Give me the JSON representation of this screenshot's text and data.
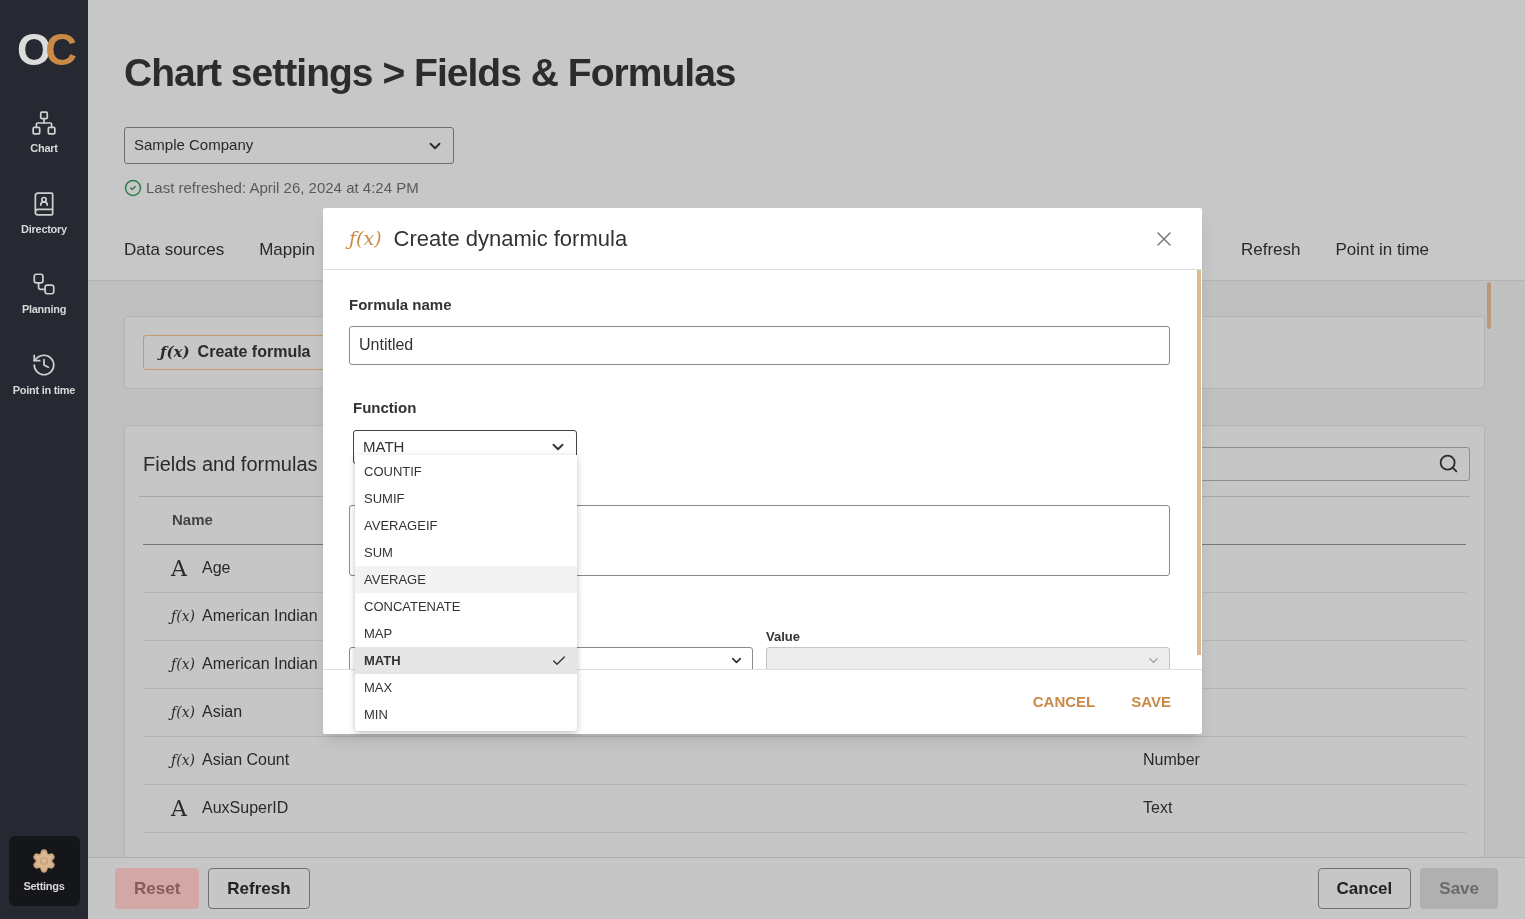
{
  "sidebar": {
    "logo": "OC",
    "items": [
      {
        "label": "Chart",
        "selected": false
      },
      {
        "label": "Directory",
        "selected": false
      },
      {
        "label": "Planning",
        "selected": false
      },
      {
        "label": "Point in time",
        "selected": false
      },
      {
        "label": "Settings",
        "selected": true
      }
    ]
  },
  "page": {
    "title": "Chart settings > Fields & Formulas",
    "company_select": {
      "value": "Sample Company"
    },
    "status": "Last refreshed: April 26, 2024 at 4:24 PM",
    "tabs": [
      {
        "label": "Data sources"
      },
      {
        "label": "Mappin"
      },
      {
        "label": "Refresh"
      },
      {
        "label": "Point in time"
      }
    ],
    "create_button": {
      "icon": "ƒ(x)",
      "label": "Create formula"
    },
    "fields": {
      "title": "Fields and formulas",
      "columns": [
        "Name"
      ],
      "rows": [
        {
          "icon": "A",
          "name": "Age"
        },
        {
          "icon": "ƒ(x)",
          "name": "American Indian"
        },
        {
          "icon": "ƒ(x)",
          "name": "American Indian"
        },
        {
          "icon": "ƒ(x)",
          "name": "Asian"
        },
        {
          "icon": "ƒ(x)",
          "name": "Asian Count",
          "type": "Number"
        },
        {
          "icon": "A",
          "name": "AuxSuperID",
          "type": "Text"
        }
      ]
    },
    "footer": {
      "left": [
        {
          "label": "Reset",
          "kind": "danger",
          "disabled": true
        },
        {
          "label": "Refresh",
          "kind": "outline",
          "disabled": false
        }
      ],
      "right": [
        {
          "label": "Cancel",
          "kind": "outline",
          "disabled": false
        },
        {
          "label": "Save",
          "kind": "primary",
          "disabled": true
        }
      ]
    }
  },
  "modal": {
    "icon": "ƒ(x)",
    "title": "Create dynamic formula",
    "formula_name": {
      "label": "Formula name",
      "value": "Untitled"
    },
    "function": {
      "label": "Function",
      "value": "MATH",
      "expanded": true,
      "options": [
        {
          "label": "COUNTIF",
          "selected": false,
          "hovered": false
        },
        {
          "label": "SUMIF",
          "selected": false,
          "hovered": false
        },
        {
          "label": "AVERAGEIF",
          "selected": false,
          "hovered": false
        },
        {
          "label": "SUM",
          "selected": false,
          "hovered": false
        },
        {
          "label": "AVERAGE",
          "selected": false,
          "hovered": true
        },
        {
          "label": "CONCATENATE",
          "selected": false,
          "hovered": false
        },
        {
          "label": "MAP",
          "selected": false,
          "hovered": false
        },
        {
          "label": "MATH",
          "selected": true,
          "hovered": false
        },
        {
          "label": "MAX",
          "selected": false,
          "hovered": false
        },
        {
          "label": "MIN",
          "selected": false,
          "hovered": false
        }
      ]
    },
    "value_field": {
      "label": "Value",
      "disabled": true
    },
    "actions": [
      "CANCEL",
      "SAVE"
    ]
  }
}
